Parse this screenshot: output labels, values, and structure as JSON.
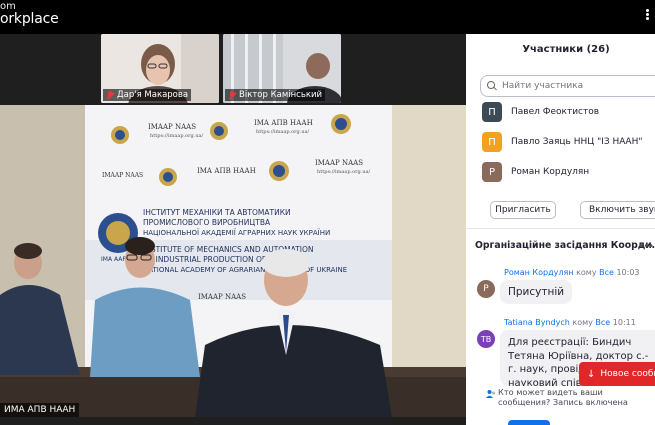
{
  "app": {
    "brand_top": "om",
    "brand_main": "orkplace"
  },
  "video": {
    "thumbnails": [
      {
        "name": "Дар'я Макарова",
        "muted": true
      },
      {
        "name": "Віктор Камінський",
        "muted": true
      }
    ],
    "main_label": "ИМА АПВ НААН",
    "wall_text": {
      "imaap_naas": "IMAAP NAAS",
      "imaap_naas_url": "https://imaap.org.ua/",
      "ima_apv_naan": "IMA АПВ НААН",
      "ima_apv_naan_url": "https://imaap.org.ua/",
      "institute_ua_1": "ІНСТИТУТ МЕХАНІКИ ТА АВТОМАТИКИ",
      "institute_ua_2": "ПРОМИСЛОВОГО ВИРОБНИЦТВА",
      "institute_ua_3": "НАЦІОНАЛЬНОЇ АКАДЕМІЇ АГРАРНИХ НАУК УКРАЇНИ",
      "institute_en_1": "INSTITUTE OF MECHANICS AND AUTOMATION",
      "institute_en_2": "OF INDUSTRIAL PRODUCTION OF THE",
      "institute_en_3": "NATIONAL ACADEMY OF AGRARIAN SCIENCES OF UKRAINE",
      "logo_text": "IMA AAP"
    }
  },
  "panel": {
    "title": "Участники (26)",
    "search_placeholder": "Найти участника",
    "participants": [
      {
        "initial": "П",
        "name": "Павел Феоктистов",
        "color": "#3c4a56"
      },
      {
        "initial": "П",
        "name": "Павло Заяць ННЦ \"ІЗ НААН\"",
        "color": "#f0a220"
      },
      {
        "initial": "Р",
        "name": "Роман Кордулян",
        "color": "#8a6a5a"
      }
    ],
    "invite_label": "Пригласить",
    "enable_all_label": "Включить звук всем",
    "chat_title": "Організаційне засідання Коорди…",
    "messages": [
      {
        "initials": "Р",
        "sender": "Роман Кордулян",
        "to_word": "кому",
        "to": "Все",
        "time": "10:03",
        "text": "Присутній",
        "avatar_color": "#8a6a5a"
      },
      {
        "initials": "TB",
        "sender": "Tatiana Byndych",
        "to_word": "кому",
        "to": "Все",
        "time": "10:11",
        "text": "Для реєстрації: Биндич Тетяна Юріївна, доктор с.-г. наук, провідний науковий співробітник ДУ \"ІРЗ НААН\"",
        "avatar_color": "#7b3fb8"
      }
    ],
    "new_messages_label": "Новое сообщение",
    "who_can_see": "Кто может видеть ваши сообщения? Запись включена"
  }
}
